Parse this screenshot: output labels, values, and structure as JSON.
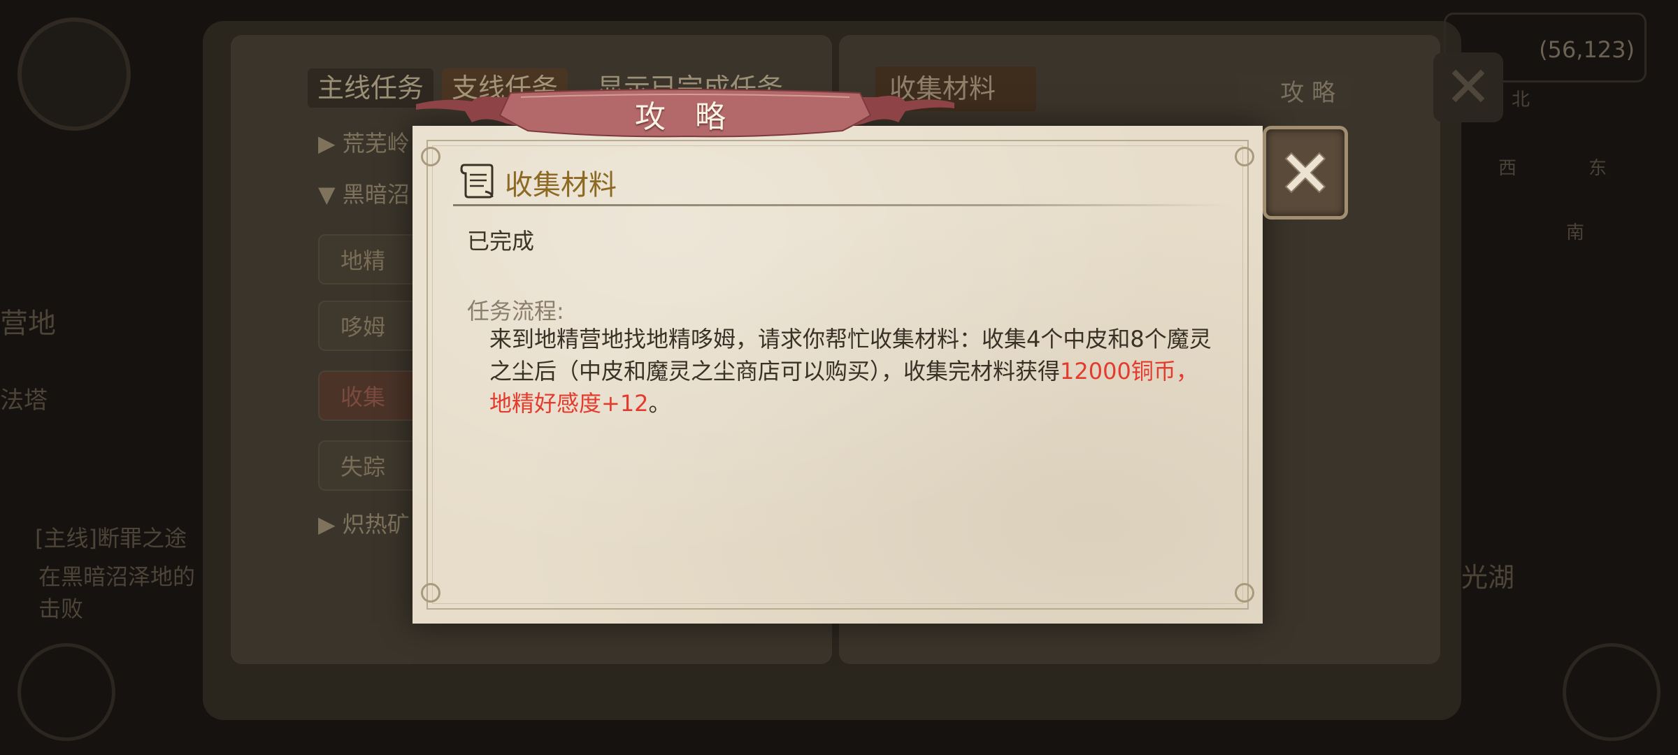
{
  "background": {
    "tabs": {
      "main_quest": "主线任务",
      "side_quest": "支线任务",
      "show_completed": "显示已完成任务",
      "collect_materials": "收集材料"
    },
    "strategy_button": "攻 略",
    "coords": "(56,123)",
    "tree_rows": [
      "荒芜岭",
      "黑暗沼"
    ],
    "sub_rows": [
      "地精",
      "哆姆",
      "收集",
      "失踪"
    ],
    "tree_row_last": "炽热矿",
    "left_labels": [
      "营地",
      "法塔"
    ],
    "quest_tracker_title": "[主线]断罪之途",
    "quest_tracker_body": "在黑暗沼泽地的击败",
    "compass": {
      "north": "北",
      "west": "西",
      "east": "东",
      "south": "南"
    },
    "right_label": "光湖"
  },
  "modal": {
    "title": "攻 略",
    "quest_name": "收集材料",
    "status": "已完成",
    "flow_label": "任务流程:",
    "flow_text_normal": "来到地精营地找地精哆姆，请求你帮忙收集材料：收集4个中皮和8个魔灵之尘后（中皮和魔灵之尘商店可以购买），收集完材料获得",
    "flow_text_highlight": "12000铜币，地精好感度+12",
    "flow_text_end": "。",
    "close_icon": "close-x-icon"
  },
  "colors": {
    "highlight": "#e33b2e",
    "quest_title": "#8c6a24",
    "ribbon": "#a9585b",
    "parchment": "#e7ddca"
  }
}
